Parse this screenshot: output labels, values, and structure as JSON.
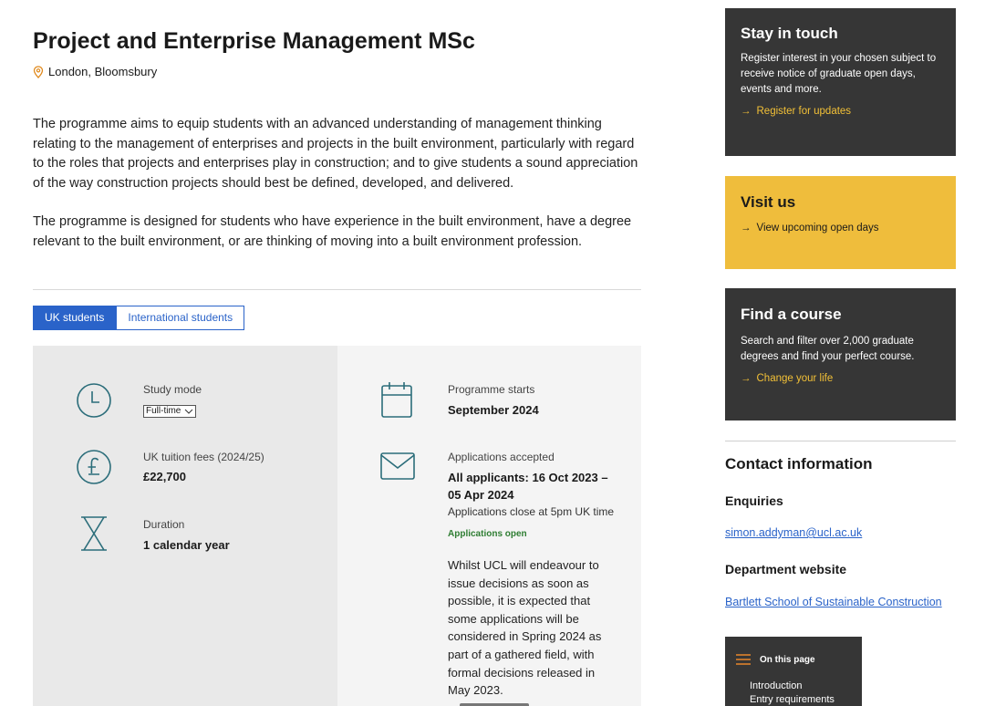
{
  "header": {
    "title": "Project and Enterprise Management MSc",
    "location": "London, Bloomsbury"
  },
  "intro": {
    "paragraph1": "The programme aims to equip students with an advanced understanding of management thinking relating to the management of enterprises and projects in the built environment, particularly with regard to the roles that projects and enterprises play in construction; and to give students a sound appreciation of the way construction projects should best be defined, developed, and delivered.",
    "paragraph2": "The programme is designed for students who have experience in the built environment, have a degree relevant to the built environment, or are thinking of moving into a built environment profession."
  },
  "tabs": [
    {
      "label": "UK students",
      "active": true
    },
    {
      "label": "International students",
      "active": false
    }
  ],
  "facts": {
    "study_mode": {
      "label": "Study mode",
      "value": "Full-time",
      "icon": "clock-icon"
    },
    "fees": {
      "label": "UK tuition fees (2024/25)",
      "value": "£22,700",
      "icon": "pound-icon"
    },
    "duration": {
      "label": "Duration",
      "value": "1 calendar year",
      "icon": "hourglass-icon"
    },
    "starts": {
      "label": "Programme starts",
      "value": "September 2024",
      "icon": "calendar-icon"
    },
    "applications": {
      "label": "Applications accepted",
      "value_line1": "All applicants: 16 Oct 2023 –",
      "value_line2": "05 Apr 2024",
      "note": "Applications close at 5pm UK time",
      "status": "Applications open",
      "icon": "envelope-icon"
    },
    "decision_text": "Whilst UCL will endeavour to issue decisions as soon as possible, it is expected that some applications will be considered in Spring 2024 as part of a gathered field, with formal decisions released in May 2023."
  },
  "sidebar": {
    "stay": {
      "title": "Stay in touch",
      "text": "Register interest in your chosen subject to receive notice of graduate open days, events and more.",
      "link": "Register for updates"
    },
    "visit": {
      "title": "Visit us",
      "link": "View upcoming open days"
    },
    "find": {
      "title": "Find a course",
      "text": "Search and filter over 2,000 graduate degrees and find your perfect course.",
      "link": "Change your life"
    },
    "contact": {
      "title": "Contact information",
      "enquiries_label": "Enquiries",
      "email": "simon.addyman@ucl.ac.uk",
      "dept_label": "Department website",
      "dept_link": "Bartlett School of Sustainable Construction"
    },
    "on_this_page": {
      "title": "On this page",
      "items": [
        "Introduction",
        "Entry requirements"
      ]
    }
  },
  "colors": {
    "accent_blue": "#2a63c9",
    "icon_teal": "#2b6d7a",
    "dark_box": "#363636",
    "yellow_box": "#efbd3c",
    "link_yellow": "#f2c037",
    "status_green": "#2e7d32"
  }
}
